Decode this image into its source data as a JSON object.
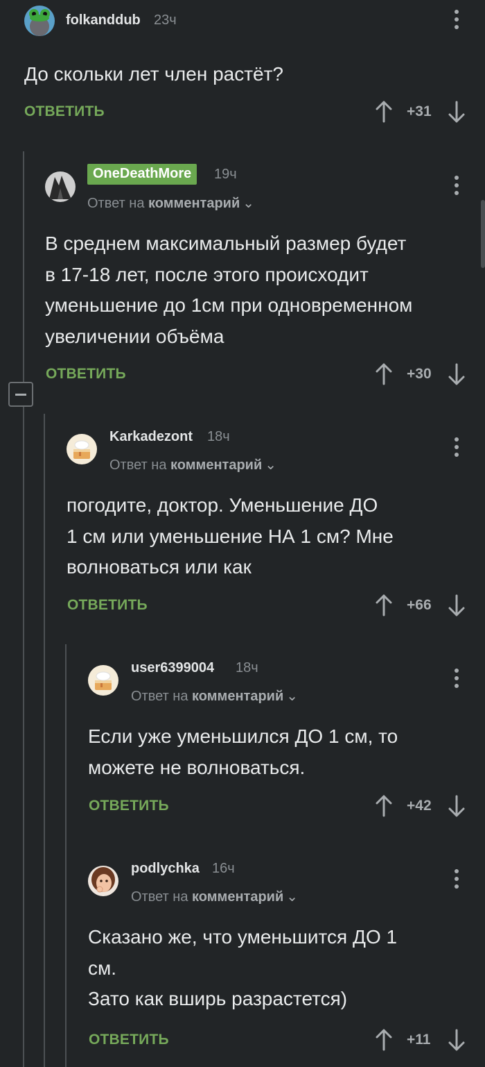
{
  "comments": [
    {
      "username": "folkanddub",
      "time": "23ч",
      "text": "До скольки лет член растёт?",
      "reply_label": "ОТВЕТИТЬ",
      "score": "+31",
      "avatar_icon": "frog-avatar-icon"
    },
    {
      "username": "OneDeathMore",
      "time": "19ч",
      "reply_prefix": "Ответ на",
      "reply_target": "комментарий",
      "text": "В среднем максимальный размер будет\nв 17-18 лет, после этого происходит\nуменьшение до 1см при одновременном\nувеличении объёма",
      "reply_label": "ОТВЕТИТЬ",
      "score": "+30",
      "badge_color": "#6aa84f",
      "avatar_icon": "dark-figure-avatar-icon"
    },
    {
      "username": "Karkadezont",
      "time": "18ч",
      "reply_prefix": "Ответ на",
      "reply_target": "комментарий",
      "text": "погодите, доктор. Уменьшение ДО\n1 см или уменьшение НА 1 см? Мне\nволноваться или как",
      "reply_label": "ОТВЕТИТЬ",
      "score": "+66",
      "avatar_icon": "cake-avatar-icon"
    },
    {
      "username": "user6399004",
      "time": "18ч",
      "reply_prefix": "Ответ на",
      "reply_target": "комментарий",
      "text": "Если уже уменьшился ДО 1 см, то\nможете не волноваться.",
      "reply_label": "ОТВЕТИТЬ",
      "score": "+42",
      "avatar_icon": "cake-avatar-icon"
    },
    {
      "username": "podlychka",
      "time": "16ч",
      "reply_prefix": "Ответ на",
      "reply_target": "комментарий",
      "text": "Сказано же, что уменьшится ДО 1\nсм.\nЗато как вширь разрастется)",
      "reply_label": "ОТВЕТИТЬ",
      "score": "+11",
      "avatar_icon": "girl-avatar-icon"
    }
  ],
  "colors": {
    "background": "#222527",
    "accent_green": "#76a95a",
    "muted_text": "#8a8f93"
  }
}
